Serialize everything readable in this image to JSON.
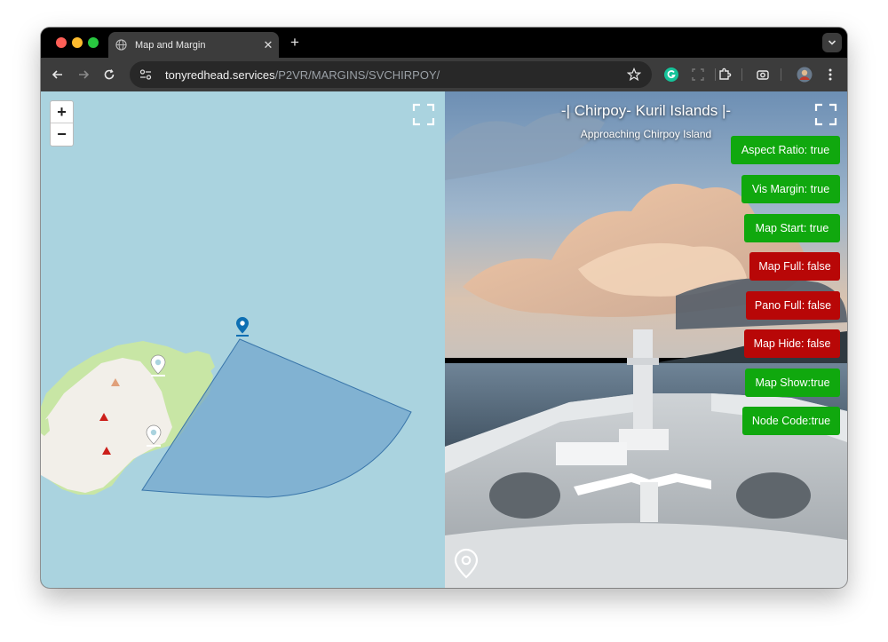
{
  "tab": {
    "title": "Map and Margin",
    "close": "✕",
    "new_tab": "+"
  },
  "address": {
    "host": "tonyredhead.services",
    "path": "/P2VR/MARGINS/SVCHIRPOY/"
  },
  "map": {
    "zoom_in": "+",
    "zoom_out": "−"
  },
  "pano": {
    "title": "-| Chirpoy- Kuril Islands |-",
    "subtitle": "Approaching Chirpoy Island",
    "flags": [
      {
        "label": "Aspect Ratio: true",
        "state": "true"
      },
      {
        "label": "Vis Margin: true",
        "state": "true"
      },
      {
        "label": "Map Start: true",
        "state": "true"
      },
      {
        "label": "Map Full: false",
        "state": "false"
      },
      {
        "label": "Pano Full: false",
        "state": "false"
      },
      {
        "label": "Map Hide: false",
        "state": "false"
      },
      {
        "label": "Map Show:true",
        "state": "true"
      },
      {
        "label": "Node Code:true",
        "state": "true"
      }
    ]
  },
  "colors": {
    "true_button": "#10a80e",
    "false_button": "#b80707",
    "water": "#aad3df",
    "land": "#f2efe9",
    "forest": "#c8e6a5",
    "view_cone": "#6b9fcb",
    "pin_blue": "#0d6fb3"
  }
}
